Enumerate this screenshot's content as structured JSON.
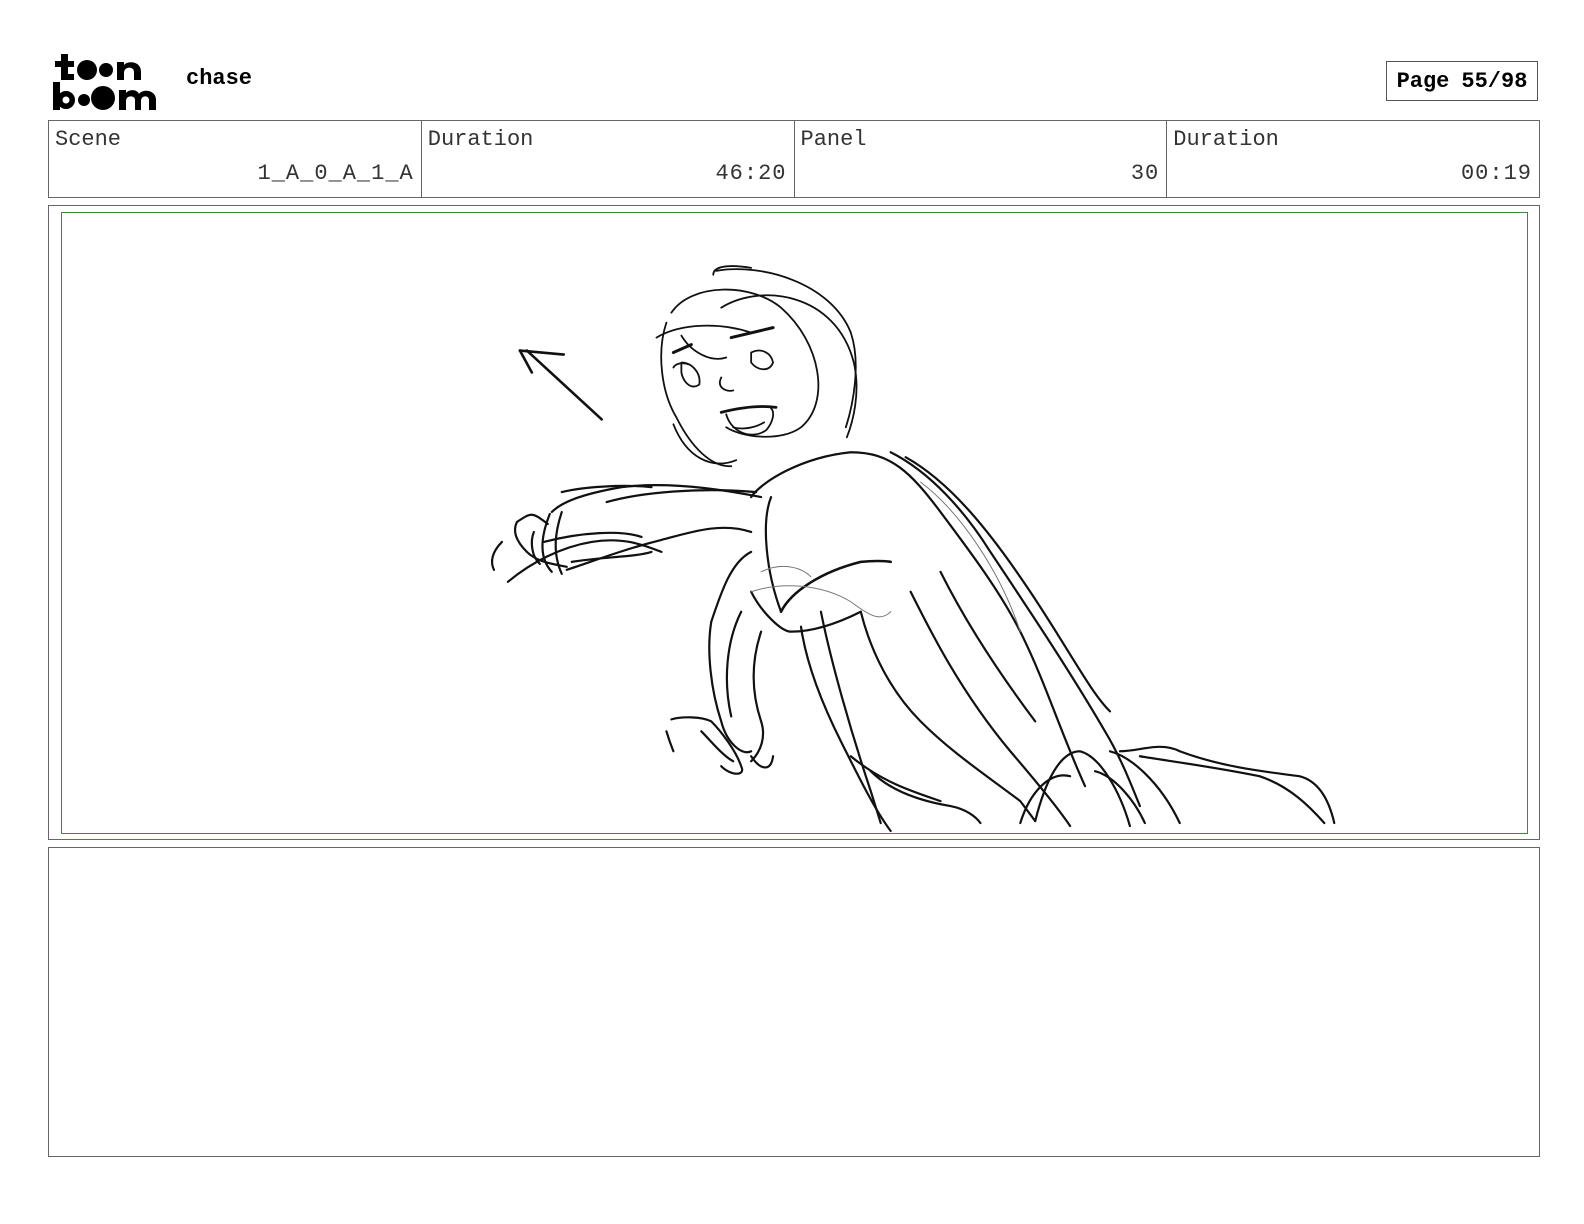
{
  "header": {
    "logo_text": "toon boom",
    "project_title": "chase",
    "page_label": "Page",
    "page_value": "55/98"
  },
  "info": {
    "scene_label": "Scene",
    "scene_value": "1_A_0_A_1_A",
    "scene_duration_label": "Duration",
    "scene_duration_value": "46:20",
    "panel_label": "Panel",
    "panel_value": "30",
    "panel_duration_label": "Duration",
    "panel_duration_value": "00:19"
  },
  "colors": {
    "safe_area_border": "#3a8a3a",
    "frame_border": "#666666",
    "sketch_stroke": "#111111"
  }
}
